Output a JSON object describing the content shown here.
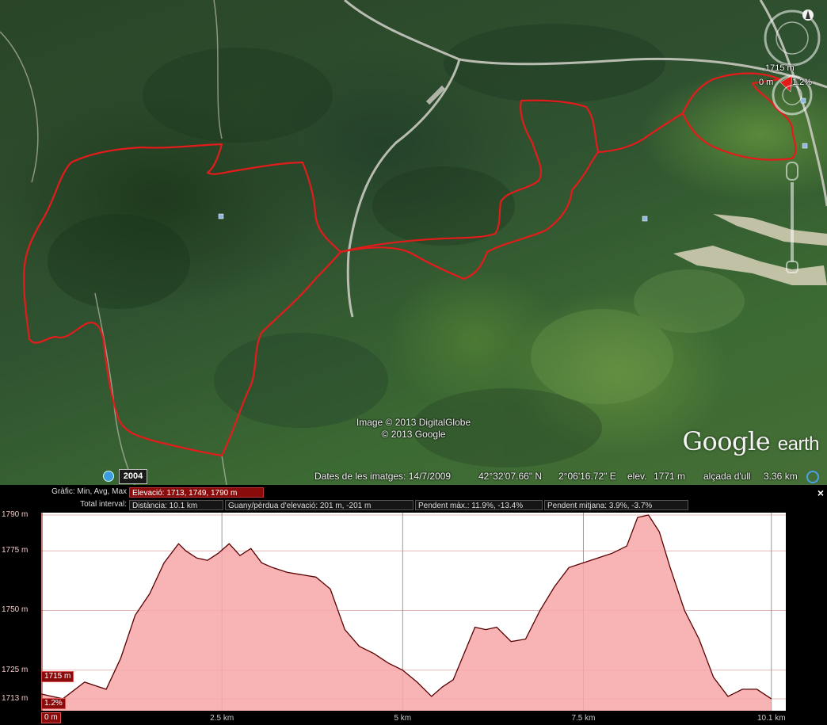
{
  "map": {
    "attribution_image": "Image © 2013 DigitalGlobe",
    "attribution_google": "© 2013 Google",
    "logo_google": "Google",
    "logo_earth": "earth",
    "year": "2004",
    "status": {
      "imagery_date": "Dates de les imatges: 14/7/2009",
      "latitude": "42°32'07.66\" N",
      "longitude": "2°06'16.72\" E",
      "elevation_label": "elev.",
      "elevation": "1771 m",
      "eye_alt_label": "alçada d'ull",
      "eye_alt": "3.36 km"
    },
    "marker": {
      "elevation": "1715 m",
      "distance": "0 m",
      "slope": "1.2%"
    },
    "track_color": "#e41b1b"
  },
  "profile": {
    "row1_label": "Gràfic: Min, Avg, Max",
    "row1_value": "Elevació: 1713, 1749, 1790 m",
    "row2_label": "Total interval:",
    "distance": "Distància: 10.1 km",
    "gain_loss": "Guany/pèrdua d'elevació: 201 m, -201 m",
    "max_slope": "Pendent màx.: 11.9%, -13.4%",
    "avg_slope": "Pendent mitjana: 3.9%, -3.7%",
    "close_label": "×",
    "cursor_elevation": "1715 m",
    "cursor_slope": "1.2%",
    "cursor_distance": "0 m"
  },
  "chart_data": {
    "type": "area",
    "fill_color": "#f7a6a8",
    "line_color": "#5a0000",
    "ylim": [
      1708,
      1791
    ],
    "xlim": [
      0,
      10.3
    ],
    "y_ticks": [
      {
        "value": 1713,
        "label": "1713 m"
      },
      {
        "value": 1725,
        "label": "1725 m"
      },
      {
        "value": 1750,
        "label": "1750 m"
      },
      {
        "value": 1775,
        "label": "1775 m"
      },
      {
        "value": 1790,
        "label": "1790 m"
      }
    ],
    "x_ticks": [
      {
        "value": 2.5,
        "label": "2.5 km"
      },
      {
        "value": 5,
        "label": "5 km"
      },
      {
        "value": 7.5,
        "label": "7.5 km"
      },
      {
        "value": 10.1,
        "label": "10.1 km"
      }
    ],
    "x": [
      0,
      0.3,
      0.6,
      0.9,
      1.1,
      1.3,
      1.5,
      1.7,
      1.9,
      2.0,
      2.15,
      2.3,
      2.45,
      2.6,
      2.75,
      2.9,
      3.05,
      3.2,
      3.4,
      3.6,
      3.8,
      4.0,
      4.2,
      4.4,
      4.6,
      4.8,
      5.0,
      5.2,
      5.4,
      5.55,
      5.7,
      5.85,
      6.0,
      6.15,
      6.3,
      6.5,
      6.7,
      6.9,
      7.1,
      7.3,
      7.5,
      7.7,
      7.9,
      8.1,
      8.25,
      8.4,
      8.55,
      8.7,
      8.9,
      9.1,
      9.3,
      9.5,
      9.7,
      9.9,
      10.1
    ],
    "y": [
      1715,
      1713,
      1720,
      1717,
      1730,
      1748,
      1757,
      1770,
      1778,
      1775,
      1772,
      1771,
      1774,
      1778,
      1773,
      1776,
      1770,
      1768,
      1766,
      1765,
      1764,
      1759,
      1742,
      1735,
      1732,
      1728,
      1725,
      1720,
      1714,
      1718,
      1721,
      1732,
      1743,
      1742,
      1743,
      1737,
      1738,
      1750,
      1760,
      1768,
      1770,
      1772,
      1774,
      1777,
      1789,
      1790,
      1783,
      1768,
      1750,
      1738,
      1722,
      1714,
      1717,
      1717,
      1713
    ]
  }
}
